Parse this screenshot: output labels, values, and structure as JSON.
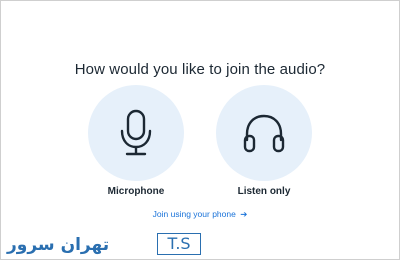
{
  "dialog": {
    "title": "How would you like to join the audio?",
    "options": [
      {
        "label": "Microphone",
        "icon": "microphone-icon"
      },
      {
        "label": "Listen only",
        "icon": "headphones-icon"
      }
    ],
    "join_phone_label": "Join using your phone",
    "join_phone_arrow": "➔"
  },
  "watermark": {
    "persian_text": "تهران سرور",
    "box_text": "T.S"
  },
  "colors": {
    "title_text": "#1c2833",
    "circle_bg": "#e6f0fa",
    "link": "#1a73d9",
    "icon_stroke": "#1c2833",
    "watermark": "#2a6fb0"
  }
}
